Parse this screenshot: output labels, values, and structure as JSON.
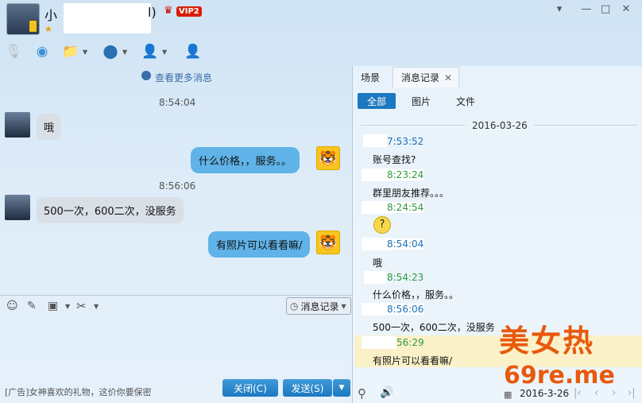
{
  "header": {
    "nick_start": "小",
    "nick_end": "l)",
    "vip_badge": "VIP2",
    "signature_start": "★"
  },
  "window_controls": {
    "dropdown": "▾",
    "minimize": "—",
    "maximize": "□",
    "close": "✕"
  },
  "chat": {
    "view_more": "查看更多消息",
    "messages": [
      {
        "time": "8:54:04",
        "side": "left",
        "text": "哦"
      },
      {
        "side": "right",
        "text": "什么价格，，服务。。"
      },
      {
        "time": "8:56:06",
        "side": "left",
        "text": "500一次，600二次，没服务"
      },
      {
        "side": "right",
        "text": "有照片可以看看嘛/"
      }
    ]
  },
  "input": {
    "ad_text": "[广告]女神喜欢的礼物，这价你要保密",
    "history_button": "消息记录",
    "close_button": "关闭(C)",
    "send_button": "发送(S)"
  },
  "history_panel": {
    "tabs": [
      "场景",
      "消息记录"
    ],
    "filters": [
      "全部",
      "图片",
      "文件"
    ],
    "date": "2016-03-26",
    "entries": [
      {
        "time": "7:53:52",
        "msg": "账号查找?",
        "color": "#1f6fb5"
      },
      {
        "time": "8:23:24",
        "msg": "群里朋友推荐。。。",
        "color": "#2e9a3c"
      },
      {
        "time": "8:24:54",
        "msg": "",
        "color": "#2e9a3c"
      },
      {
        "time": "8:54:04",
        "msg": "哦",
        "color": "#1f6fb5"
      },
      {
        "time": "8:54:23",
        "msg": "什么价格，，服务。。",
        "color": "#2e9a3c"
      },
      {
        "time": "8:56:06",
        "msg": "500一次，600二次，没服务",
        "color": "#1f6fb5"
      },
      {
        "time": "56:29",
        "msg": "有照片可以看看嘛/",
        "color": "#2e9a3c"
      }
    ],
    "footer_date": "2016-3-26"
  },
  "watermark": {
    "line1": "美女热",
    "line2": "69re.me"
  },
  "colors": {
    "accent": "#1c78c0",
    "bubble_right": "#5fb3e8",
    "bubble_left": "#d9dfe6"
  }
}
